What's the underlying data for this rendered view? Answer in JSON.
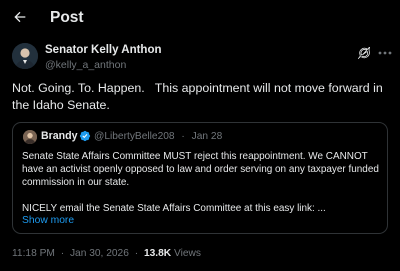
{
  "header": {
    "title": "Post",
    "back_icon": "arrow-left-icon"
  },
  "post": {
    "author_name": "Senator Kelly Anthon",
    "author_handle": "@kelly_a_anthon",
    "text": "Not. Going. To. Happen.   This appointment will not move forward in the Idaho Senate.",
    "time": "11:18 PM",
    "date": "Jan 30, 2026",
    "views_count": "13.8K",
    "views_label": "Views",
    "separator": "·"
  },
  "quote": {
    "author_name": "Brandy",
    "verified": true,
    "handle": "@LibertyBelle208",
    "separator": "·",
    "date": "Jan 28",
    "paragraph1": "Senate State Affairs Committee MUST reject this reappointment. We CANNOT have an activist openly opposed to law and order serving on any taxpayer funded commission in our state.",
    "paragraph2": "NICELY email the Senate State Affairs Committee at this easy link: ...",
    "show_more": "Show more"
  },
  "colors": {
    "background": "#000000",
    "text": "#e7e9ea",
    "secondary": "#71767b",
    "accent": "#1d9bf0",
    "border": "#2f3336"
  }
}
